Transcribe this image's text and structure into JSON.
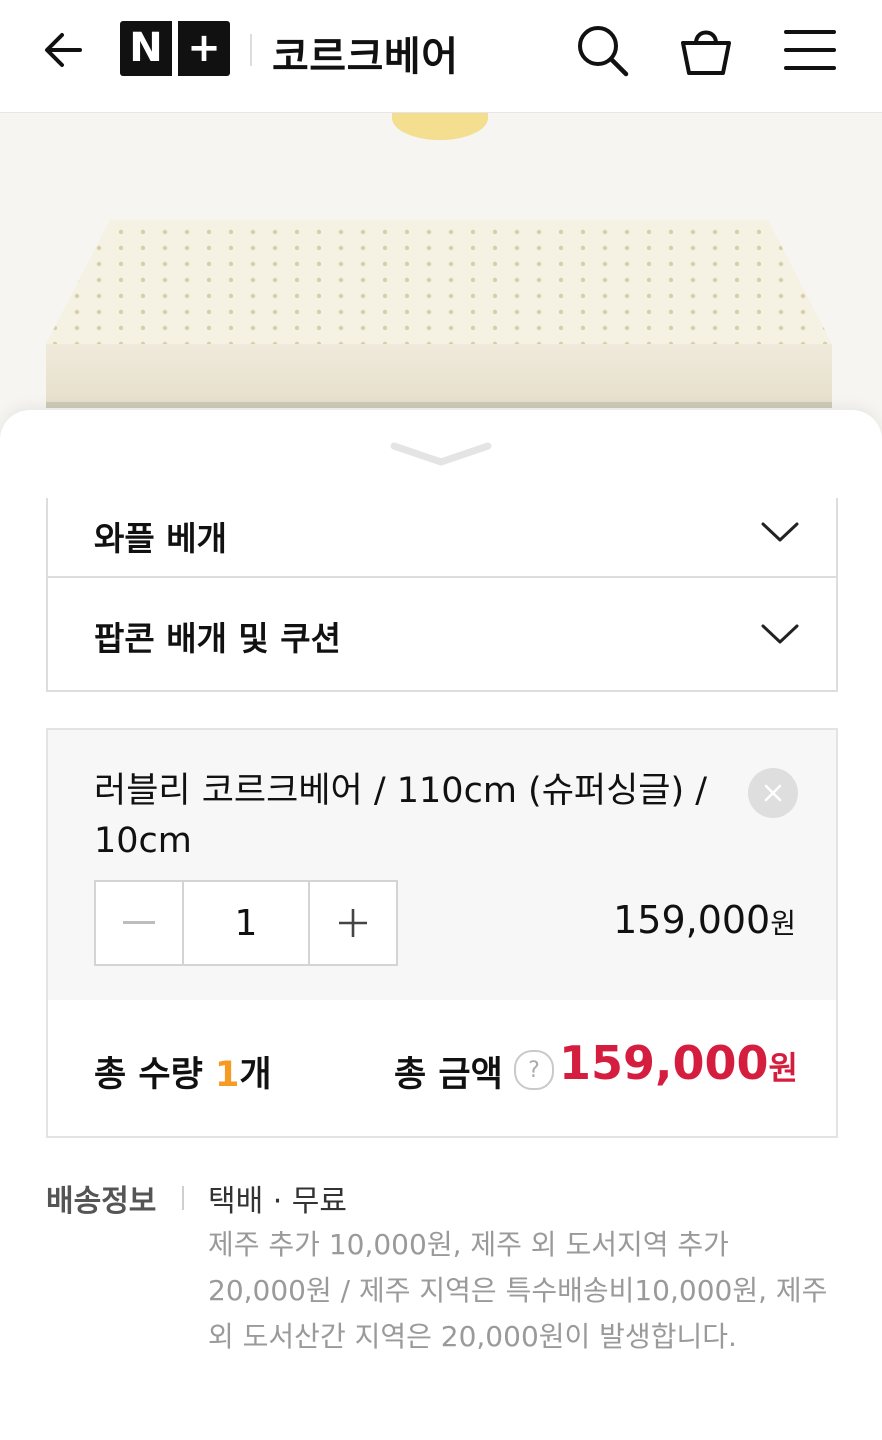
{
  "header": {
    "logo_text": "N+",
    "store_name": "코르크베어",
    "icons": [
      "back-arrow-icon",
      "search-icon",
      "cart-icon",
      "menu-icon"
    ]
  },
  "options": [
    {
      "label": "와플 베개"
    },
    {
      "label": "팝콘 배개 및 쿠션"
    }
  ],
  "selected_item": {
    "name": "러블리 코르크베어 / 110cm (슈퍼싱글) / 10cm",
    "quantity": "1",
    "price": "159,000",
    "currency": "원"
  },
  "totals": {
    "qty_label_prefix": "총 수량 ",
    "qty_value": "1",
    "qty_suffix": "개",
    "amount_label": "총 금액",
    "help": "?",
    "amount": "159,000",
    "currency": "원"
  },
  "shipping": {
    "label": "배송정보",
    "method": "택배 · 무료",
    "description": "제주 추가 10,000원, 제주 외 도서지역 추가 20,000원 / 제주 지역은 특수배송비10,000원, 제주 외 도서산간 지역은 20,000원이 발생합니다."
  },
  "colors": {
    "price_red": "#d51e3f",
    "qty_orange": "#f59a23",
    "border": "#dddddd"
  }
}
